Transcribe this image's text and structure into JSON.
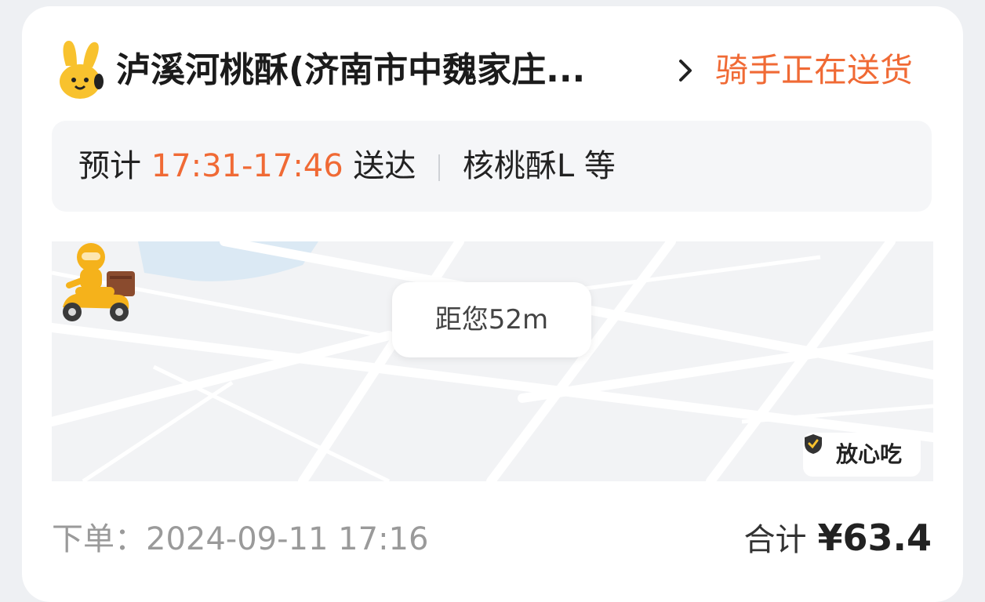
{
  "order_card": {
    "shop_name": "泸溪河桃酥(济南市中魏家庄...",
    "status": "骑手正在送货",
    "eta": {
      "prefix": "预计",
      "time_range": "17:31-17:46",
      "suffix": "送达",
      "items": "核桃酥L 等"
    },
    "map": {
      "distance_label": "距您52m",
      "badge_label": "放心吃"
    },
    "order_time": "下单：2024-09-11 17:16",
    "total_label": "合计",
    "total_value": "¥63.4"
  },
  "icons": {
    "logo": "rabbit-logo-icon",
    "chevron": "chevron-right-icon",
    "rider": "delivery-rider-icon",
    "badge": "shield-icon"
  },
  "colors": {
    "accent": "#f06a35",
    "logo_yellow": "#f8c22e",
    "rider_yellow": "#f5b21b"
  }
}
